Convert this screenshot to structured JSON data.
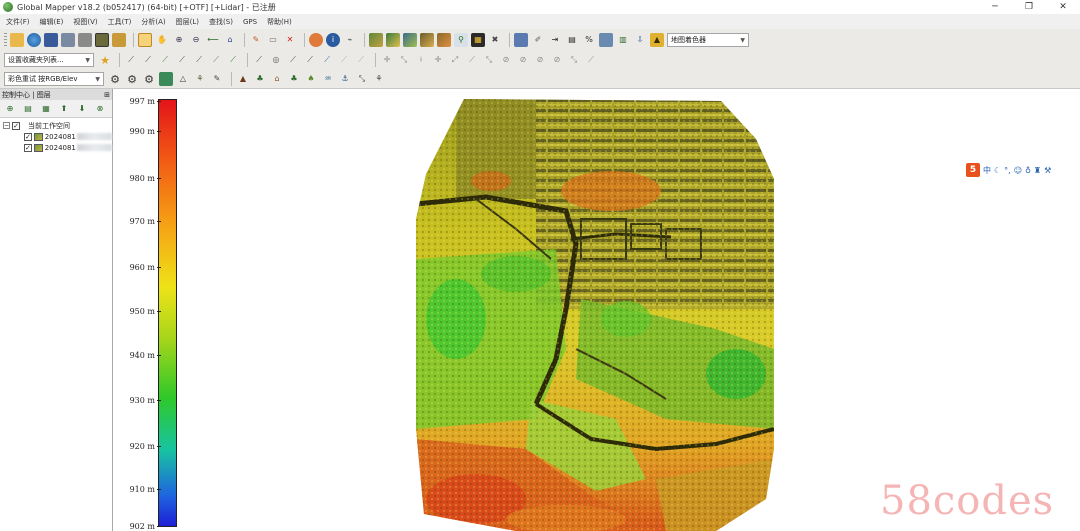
{
  "window": {
    "title": "Global Mapper v18.2 (b052417) (64-bit) [+OTF] [+Lidar] - 已注册",
    "controls": [
      "─",
      "❐",
      "✕"
    ]
  },
  "menu": [
    "文件(F)",
    "编辑(E)",
    "视图(V)",
    "工具(T)",
    "分析(A)",
    "图层(L)",
    "查找(S)",
    "GPS",
    "帮助(H)"
  ],
  "toolbar": {
    "shader_dropdown": "地图着色器",
    "favorites_dropdown": "设置收藏夹列表...",
    "color_mode_dropdown": "彩色重试 按RGB/Elev"
  },
  "control_center": {
    "title": "控制中心 | 图层",
    "pin": "⊞",
    "workspace_label": "当前工作空间",
    "layers": [
      "2024081",
      "2024081"
    ]
  },
  "legend": {
    "ticks": [
      "997 m",
      "990 m",
      "980 m",
      "970 m",
      "960 m",
      "950 m",
      "940 m",
      "930 m",
      "920 m",
      "910 m",
      "902 m"
    ]
  },
  "ime": {
    "logo": "5",
    "mode": "中"
  },
  "watermark": "58codes",
  "colors": {
    "legend_top": "#e4141a",
    "legend_bottom": "#1e1ed6",
    "toolbar_bg": "#eceae6"
  }
}
